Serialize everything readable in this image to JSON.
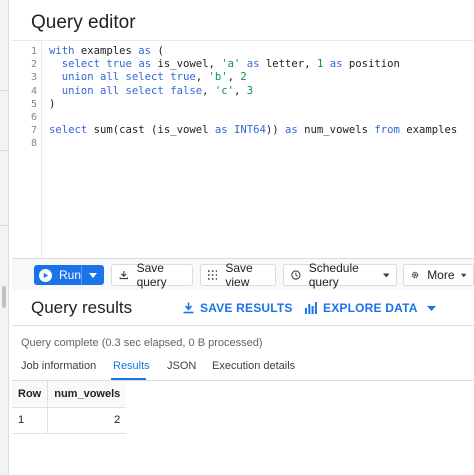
{
  "editor": {
    "title": "Query editor",
    "line_numbers": [
      "1",
      "2",
      "3",
      "4",
      "5",
      "6",
      "7",
      "8"
    ]
  },
  "code": {
    "l1": {
      "kw1": "with",
      "t1": " examples ",
      "kw2": "as",
      "t2": " ("
    },
    "l2": {
      "sp": "  ",
      "kw1": "select",
      "kw2": " true",
      "kw3": " as",
      "t1": " is_vowel, ",
      "s1": "'a'",
      "kw4": " as",
      "t2": " letter, ",
      "n1": "1",
      "kw5": " as",
      "t3": " position"
    },
    "l3": {
      "sp": "  ",
      "kw1": "union all select",
      "kw2": " true",
      "t1": ", ",
      "s1": "'b'",
      "t2": ", ",
      "n1": "2"
    },
    "l4": {
      "sp": "  ",
      "kw1": "union all select",
      "kw2": " false",
      "t1": ", ",
      "s1": "'c'",
      "t2": ", ",
      "n1": "3"
    },
    "l5": {
      "t1": ")"
    },
    "l7": {
      "kw1": "select",
      "t1": " sum(cast (is_vowel ",
      "kw2": "as",
      "kw3": " INT64",
      "t2": ")) ",
      "kw4": "as",
      "t3": " num_vowels ",
      "kw5": "from",
      "t4": " examples"
    }
  },
  "toolbar": {
    "run_label": "Run",
    "save_query_label": "Save query",
    "save_view_label": "Save view",
    "schedule_query_label": "Schedule query",
    "more_label": "More"
  },
  "results": {
    "title": "Query results",
    "save_results_label": "SAVE RESULTS",
    "explore_data_label": "EXPLORE DATA",
    "status": "Query complete (0.3 sec elapsed, 0 B processed)",
    "tabs": [
      {
        "label": "Job information"
      },
      {
        "label": "Results"
      },
      {
        "label": "JSON"
      },
      {
        "label": "Execution details"
      }
    ],
    "active_tab": "Results",
    "table": {
      "headers": [
        "Row",
        "num_vowels"
      ],
      "rows": [
        [
          "1",
          "2"
        ]
      ]
    }
  },
  "colors": {
    "accent": "#1a73e8",
    "keyword": "#3367d6",
    "literal": "#0d904f"
  }
}
